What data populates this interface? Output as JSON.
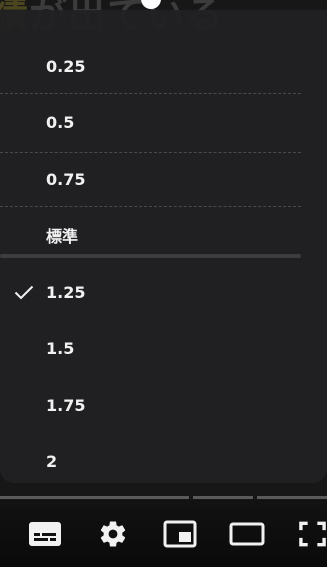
{
  "video": {
    "caption_highlight": "績",
    "caption_rest": "が出ている"
  },
  "speed_menu": {
    "options": [
      {
        "label": "0.25",
        "selected": false
      },
      {
        "label": "0.5",
        "selected": false
      },
      {
        "label": "0.75",
        "selected": false
      },
      {
        "label": "標準",
        "selected": false
      },
      {
        "label": "1.25",
        "selected": true
      },
      {
        "label": "1.5",
        "selected": false
      },
      {
        "label": "1.75",
        "selected": false
      },
      {
        "label": "2",
        "selected": false
      }
    ]
  },
  "controls": {
    "icons": [
      "subtitles-icon",
      "settings-gear-icon",
      "miniplayer-icon",
      "theater-mode-icon",
      "fullscreen-icon"
    ]
  },
  "colors": {
    "menu_bg": "#212123",
    "text": "#f1f1f1",
    "divider": "#4a4a4a"
  }
}
